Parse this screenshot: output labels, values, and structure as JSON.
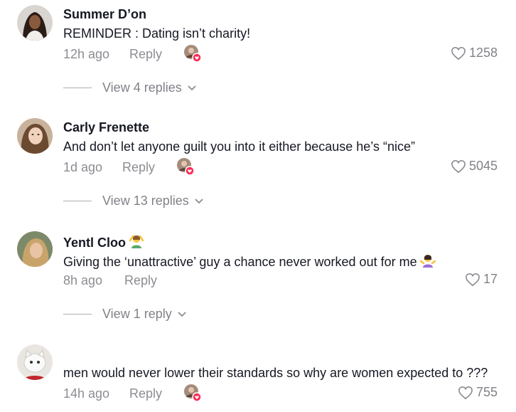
{
  "comments": [
    {
      "username": "Summer D’on",
      "text": "REMINDER : Dating isn’t charity!",
      "time": "12h ago",
      "reply": "Reply",
      "likes": "1258",
      "view_replies": "View 4 replies"
    },
    {
      "username": "Carly Frenette",
      "text": "And don’t let anyone guilt you into it either because he’s “nice”",
      "time": "1d ago",
      "reply": "Reply",
      "likes": "5045",
      "view_replies": "View 13 replies"
    },
    {
      "username": "Yentl Cloo",
      "text": "Giving the ‘unattractive’ guy a chance never worked out for me",
      "time": "8h ago",
      "reply": "Reply",
      "likes": "17",
      "view_replies": "View 1 reply"
    },
    {
      "username": "",
      "text": "men would never lower their standards so why are women expected to ???",
      "time": "14h ago",
      "reply": "Reply",
      "likes": "755"
    }
  ],
  "icons": {
    "heart": "heart-outline-icon",
    "chevron": "chevron-down-icon",
    "creator_liked": "creator-liked-badge"
  },
  "colors": {
    "badge": "#fe2c55",
    "text": "#161823",
    "muted": "#8a8b91"
  }
}
